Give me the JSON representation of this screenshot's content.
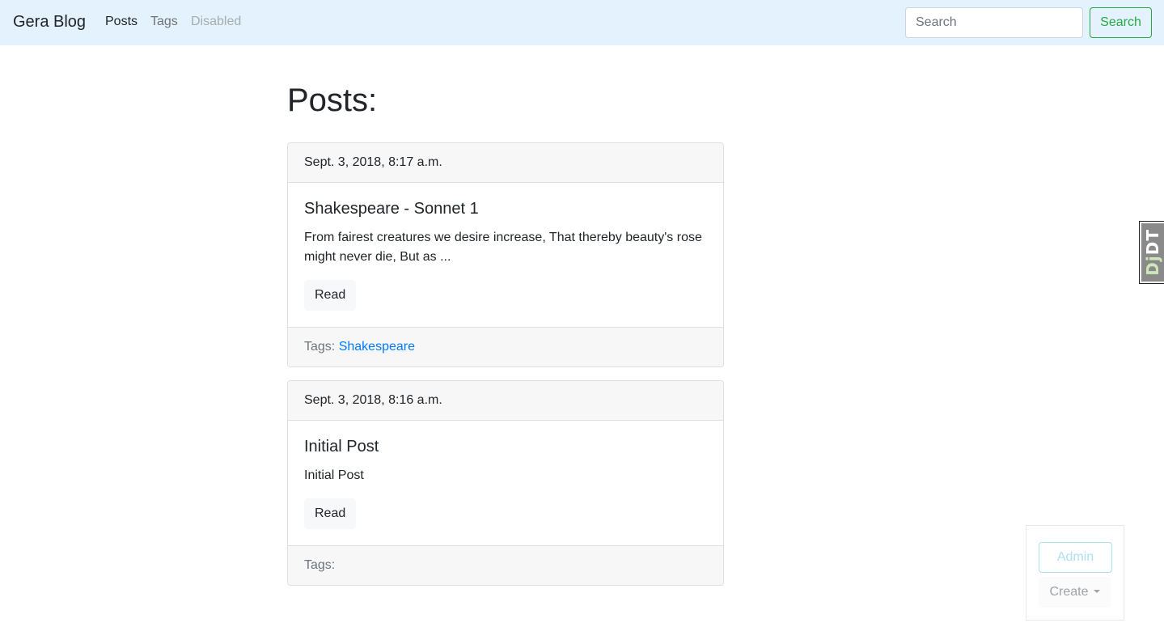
{
  "navbar": {
    "brand": "Gera Blog",
    "links": [
      {
        "label": "Posts",
        "state": "active"
      },
      {
        "label": "Tags",
        "state": "normal"
      },
      {
        "label": "Disabled",
        "state": "disabled"
      }
    ],
    "search_placeholder": "Search",
    "search_button": "Search",
    "background_color": "#e3f2fd",
    "success_color": "#28a745"
  },
  "main": {
    "title": "Posts:",
    "posts": [
      {
        "date": "Sept. 3, 2018, 8:17 a.m.",
        "title": "Shakespeare - Sonnet 1",
        "excerpt": "From fairest creatures we desire increase, That thereby beauty's rose might never die, But as ...",
        "read_label": "Read",
        "tags_label": "Tags:",
        "tags": [
          "Shakespeare"
        ]
      },
      {
        "date": "Sept. 3, 2018, 8:16 a.m.",
        "title": "Initial Post",
        "excerpt": "Initial Post",
        "read_label": "Read",
        "tags_label": "Tags:",
        "tags": []
      }
    ],
    "link_color": "#007bff"
  },
  "debug_toolbar": {
    "label_prefix": "Dj",
    "label_suffix": "DT"
  },
  "admin_panel": {
    "admin_label": "Admin",
    "create_label": "Create",
    "admin_color": "#aee1ec"
  }
}
